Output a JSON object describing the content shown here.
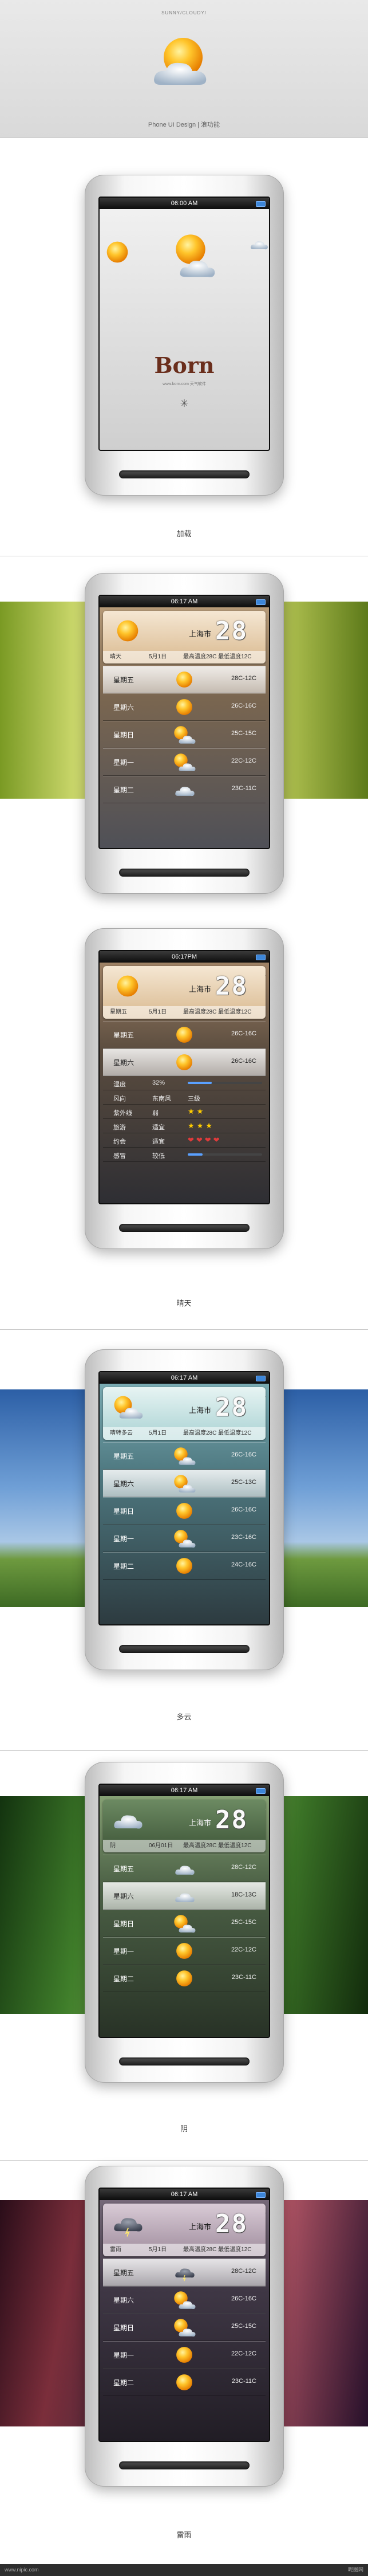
{
  "header": {
    "tiny_title": "SUNNY/CLOUDY/",
    "credit": "Phone UI Design | 浪功能"
  },
  "s1": {
    "time": "06:00 AM",
    "logo": "Born",
    "subtitle": "www.born.com 天气软件",
    "caption": "加载"
  },
  "s2": {
    "time": "06:17 AM",
    "city": "上海市",
    "temp": "28",
    "deg": "°",
    "today": "晴天",
    "date": "5月1日",
    "range": "最高温度28C 最低温度12C",
    "days": [
      {
        "label": "星期五",
        "range": "28C-12C"
      },
      {
        "label": "星期六",
        "range": "26C-16C"
      },
      {
        "label": "星期日",
        "range": "25C-15C"
      },
      {
        "label": "星期一",
        "range": "22C-12C"
      },
      {
        "label": "星期二",
        "range": "23C-11C"
      }
    ]
  },
  "s3": {
    "time": "06:17PM",
    "city": "上海市",
    "temp": "28",
    "today": "星期五",
    "date": "5月1日",
    "range": "最高温度28C 最低温度12C",
    "days": [
      {
        "label": "星期五",
        "range": "26C-16C"
      },
      {
        "label": "星期六",
        "range": "26C-16C"
      }
    ],
    "details": [
      {
        "key": "湿度",
        "val": "32%"
      },
      {
        "key": "风向",
        "val": "东南风",
        "val2": "三级"
      },
      {
        "key": "紫外线",
        "val": "弱"
      },
      {
        "key": "旅游",
        "val": "适宜"
      },
      {
        "key": "约会",
        "val": "适宜"
      },
      {
        "key": "感冒",
        "val": "较低"
      }
    ],
    "caption": "晴天"
  },
  "s4": {
    "time": "06:17 AM",
    "city": "上海市",
    "temp": "28",
    "today": "晴转多云",
    "date": "5月1日",
    "range": "最高温度28C 最低温度12C",
    "days": [
      {
        "label": "星期五",
        "range": "26C-16C"
      },
      {
        "label": "星期六",
        "range": "25C-13C"
      },
      {
        "label": "星期日",
        "range": "26C-16C"
      },
      {
        "label": "星期一",
        "range": "23C-16C"
      },
      {
        "label": "星期二",
        "range": "24C-16C"
      }
    ],
    "caption": "多云"
  },
  "s5": {
    "time": "06:17 AM",
    "city": "上海市",
    "temp": "28",
    "today": "阴",
    "date": "06月01日",
    "range": "最高温度28C 最低温度12C",
    "days": [
      {
        "label": "星期五",
        "range": "28C-12C"
      },
      {
        "label": "星期六",
        "range": "18C-13C"
      },
      {
        "label": "星期日",
        "range": "25C-15C"
      },
      {
        "label": "星期一",
        "range": "22C-12C"
      },
      {
        "label": "星期二",
        "range": "23C-11C"
      }
    ],
    "caption": "阴"
  },
  "s6": {
    "time": "06:17 AM",
    "city": "上海市",
    "temp": "28",
    "today": "雷雨",
    "date": "5月1日",
    "range": "最高温度28C 最低温度12C",
    "days": [
      {
        "label": "星期五",
        "range": "28C-12C"
      },
      {
        "label": "星期六",
        "range": "26C-16C"
      },
      {
        "label": "星期日",
        "range": "25C-15C"
      },
      {
        "label": "星期一",
        "range": "22C-12C"
      },
      {
        "label": "星期二",
        "range": "23C-11C"
      }
    ],
    "caption": "雷雨"
  },
  "footer": {
    "left": "www.nipic.com",
    "right": "昵图网"
  },
  "colors": {
    "sun": "#f5a623",
    "accent_blue": "#3d86d8"
  }
}
